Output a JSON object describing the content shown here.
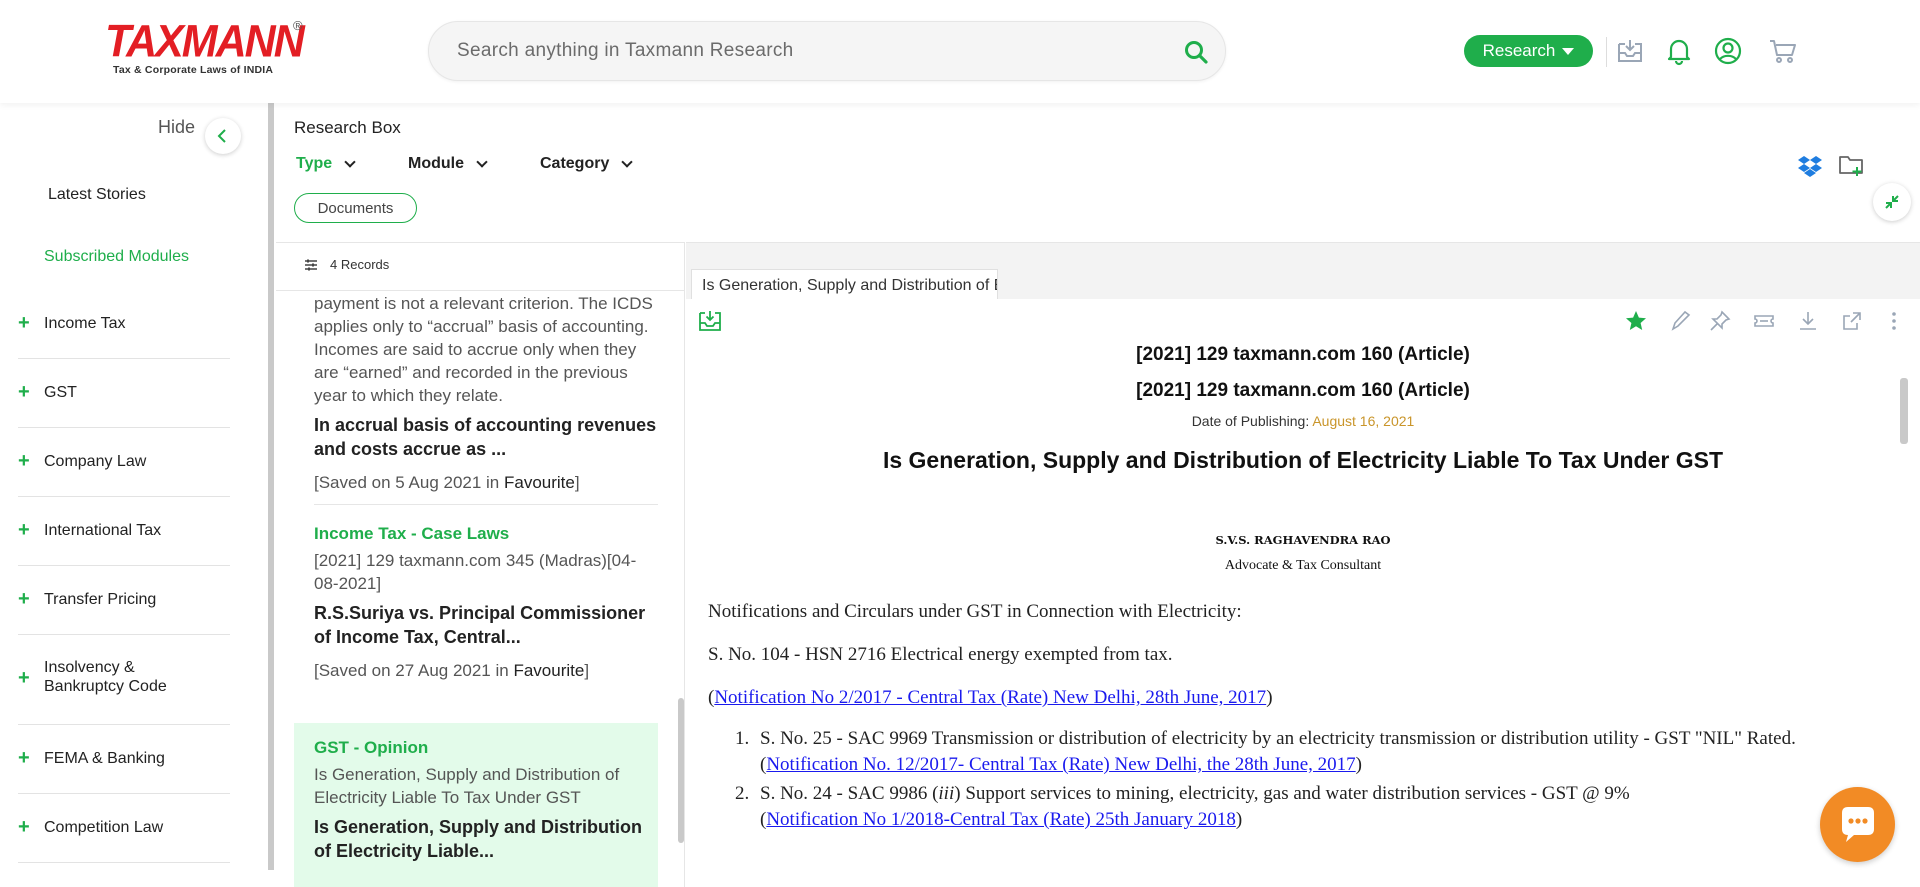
{
  "header": {
    "logo_text": "TAXMANN",
    "logo_registered": "®",
    "logo_subtitle": "Tax & Corporate Laws of INDIA",
    "search_placeholder": "Search anything in Taxmann Research",
    "research_label": "Research",
    "icons": [
      "inbox-download-icon",
      "bell-icon",
      "user-icon",
      "cart-icon"
    ],
    "accent_color": "#1fae4b",
    "brand_color": "#e31e24"
  },
  "sidebar": {
    "hide_label": "Hide",
    "latest_stories": "Latest Stories",
    "subscribed_modules": "Subscribed Modules",
    "items": [
      {
        "label": "Income Tax"
      },
      {
        "label": "GST"
      },
      {
        "label": "Company Law"
      },
      {
        "label": "International Tax"
      },
      {
        "label": "Transfer Pricing"
      },
      {
        "label": "Insolvency & Bankruptcy Code"
      },
      {
        "label": "FEMA & Banking"
      },
      {
        "label": "Competition Law"
      }
    ]
  },
  "research_box": {
    "title": "Research Box",
    "filters": [
      {
        "label": "Type"
      },
      {
        "label": "Module"
      },
      {
        "label": "Category"
      }
    ],
    "documents_pill": "Documents"
  },
  "list": {
    "records_count": "4 Records",
    "items": [
      {
        "snippet": "payment is not a relevant criterion. The ICDS applies only to “accrual” basis of accounting. Incomes are said to accrue only when they are “earned” and recorded in the previous year to which they relate.",
        "title": " In accrual basis of accounting revenues and costs accrue as ...",
        "saved_prefix": "[Saved on 5 Aug 2021 in ",
        "saved_folder": "Favourite",
        "saved_suffix": "]"
      },
      {
        "category": "Income Tax - Case Laws",
        "citation": "[2021] 129 taxmann.com 345 (Madras)[04-08-2021]",
        "title": " R.S.Suriya vs. Principal Commissioner of Income Tax, Central...",
        "saved_prefix": "[Saved on 27 Aug 2021 in ",
        "saved_folder": "Favourite",
        "saved_suffix": "]"
      },
      {
        "category": "GST - Opinion",
        "citation": "Is Generation, Supply and Distribution of Electricity Liable To Tax Under GST",
        "title": " Is Generation, Supply and Distribution of Electricity Liable..."
      }
    ]
  },
  "document": {
    "tab_label": "Is Generation, Supply and Distribution of Electricity Liable To Tax Under GST",
    "ref_line_1": "[2021] 129 taxmann.com 160 (Article)",
    "ref_line_2": "[2021] 129 taxmann.com 160 (Article)",
    "pub_label": "Date of Publishing: ",
    "pub_date": "August 16, 2021",
    "title": "Is Generation, Supply and Distribution of Electricity Liable To Tax Under GST",
    "author": "S.V.S. RAGHAVENDRA RAO",
    "author_role": "Advocate & Tax Consultant",
    "para_1": "Notifications and Circulars under GST in Connection with Electricity:",
    "para_2": "S. No. 104 - HSN 2716 Electrical energy exempted from tax.",
    "link_1_open": "(",
    "link_1": "Notification No 2/2017 - Central Tax (Rate) New Delhi, 28th June, 2017",
    "link_1_close": ")",
    "list_1_text": "S. No. 25 - SAC 9969 Transmission or distribution of electricity by an electricity transmission or distribution utility - GST \"NIL\" Rated.",
    "list_1_link": "Notification No. 12/2017- Central Tax (Rate) New Delhi, the 28th June, 2017",
    "list_2_pre": "S. No. 24 - SAC 9986 (",
    "list_2_italic": "iii",
    "list_2_post": ") Support services to mining, electricity, gas and water distribution services - GST @ 9%",
    "list_2_link": "Notification No 1/2018-Central Tax (Rate) 25th January 2018",
    "paren_open": "(",
    "paren_close": ")"
  }
}
